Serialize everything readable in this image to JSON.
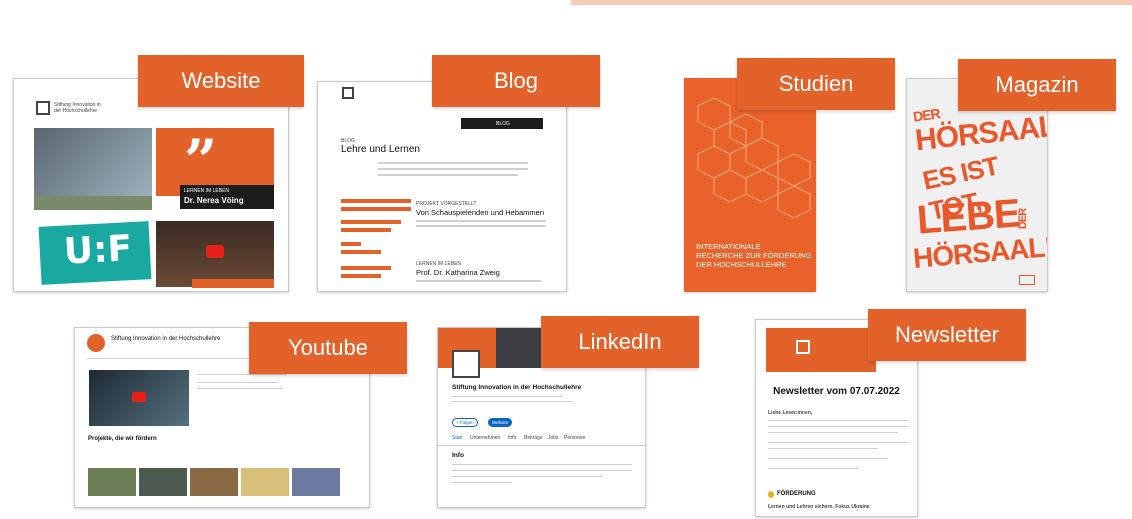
{
  "accent_color": "#e2622a",
  "labels": {
    "website": "Website",
    "blog": "Blog",
    "studien": "Studien",
    "magazin": "Magazin",
    "youtube": "Youtube",
    "linkedin": "LinkedIn",
    "newsletter": "Newsletter"
  },
  "website": {
    "org_name": "Stiftung Innovation in der Hochschullehre",
    "quote_caption": "LERNEN IM LEBEN",
    "quote_name": "Dr. Nerea Vöing"
  },
  "blog": {
    "section": "BLOG",
    "heading": "Lehre und Lernen",
    "post1_kicker": "PROJEKT VORGESTELLT",
    "post1_title": "Von Schauspielenden und Hebammen",
    "post2_kicker": "LERNEN IM LEBEN",
    "post2_title": "Prof. Dr. Katharina Zweig"
  },
  "studien": {
    "cover_text": [
      "INTERNATIONALE",
      "RECHERCHE ZUR FÖRDERUNG",
      "DER HOCHSCHULLEHRE"
    ]
  },
  "magazin": {
    "cover_words": [
      "DER",
      "HÖRSAAL",
      "ES IST TOT,",
      "LEBE",
      "DER",
      "HÖRSAAL!"
    ]
  },
  "youtube": {
    "channel_name": "Stiftung Innovation in der Hochschullehre",
    "section_title": "Projekte, die wir fördern"
  },
  "linkedin": {
    "page_name": "Stiftung Innovation in der Hochschullehre",
    "follow_label": "+ Folgen",
    "website_label": "Website",
    "tabs": [
      "Start",
      "Unternehmen",
      "Info",
      "Beiträge",
      "Jobs",
      "Personen"
    ],
    "info_heading": "Info"
  },
  "newsletter": {
    "title": "Newsletter vom 07.07.2022",
    "greeting": "Liebe Leser:innen,",
    "section_title": "FÖRDERUNG",
    "subline": "Lernen und Lehren sichern. Fokus Ukraine"
  }
}
